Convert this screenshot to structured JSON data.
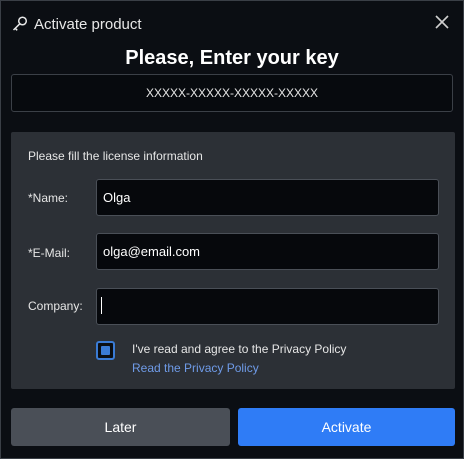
{
  "window": {
    "title": "Activate product",
    "heading": "Please, Enter your key"
  },
  "icons": {
    "title_icon": "key-icon",
    "close_icon": "close-icon"
  },
  "license_key": {
    "value": "XXXXX-XXXXX-XXXXX-XXXXX"
  },
  "form": {
    "caption": "Please fill the license information",
    "name": {
      "label": "*Name:",
      "value": "Olga"
    },
    "email": {
      "label": "*E-Mail:",
      "value": "olga@email.com"
    },
    "company": {
      "label": "Company:",
      "value": ""
    },
    "agree": {
      "text": "I've read and agree to the Privacy Policy",
      "checked": true
    },
    "privacy_link": "Read the Privacy Policy"
  },
  "buttons": {
    "later": "Later",
    "activate": "Activate"
  },
  "colors": {
    "accent": "#2f7cf6",
    "link": "#6f9be8",
    "panel": "#2c3036",
    "background": "#0b0e13"
  }
}
